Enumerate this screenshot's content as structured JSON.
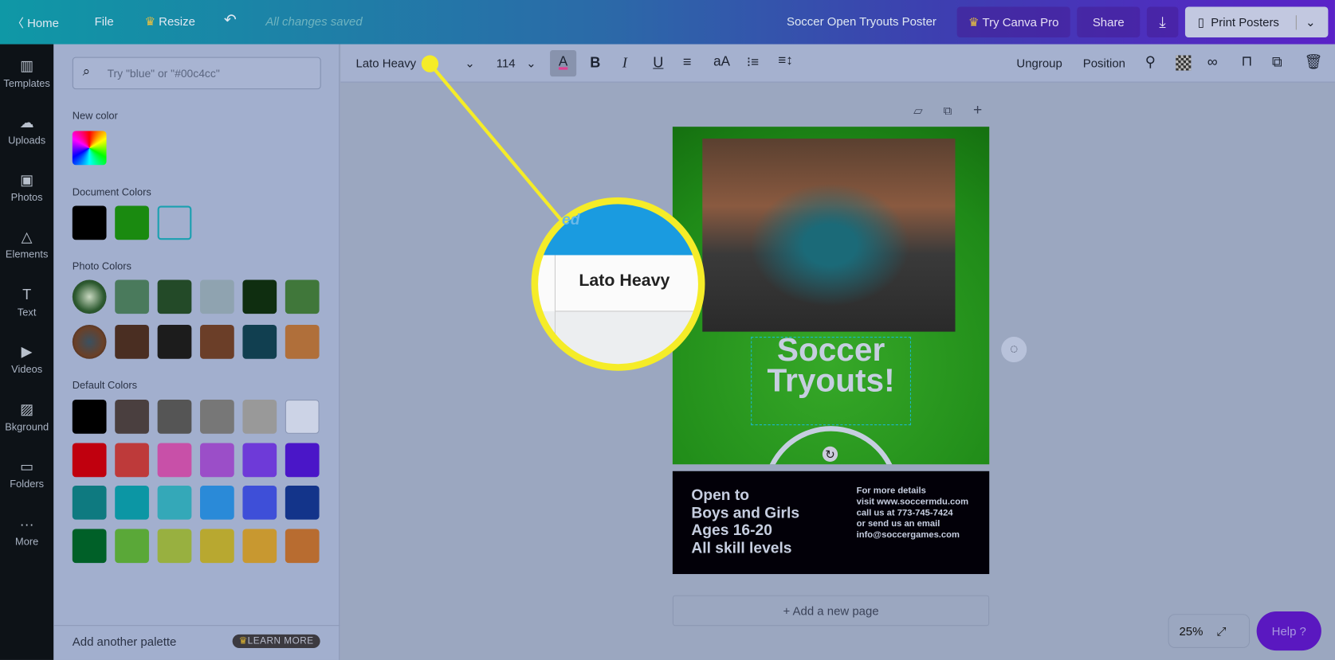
{
  "topbar": {
    "home": "Home",
    "file": "File",
    "resize": "Resize",
    "status": "All changes saved",
    "title": "Soccer Open Tryouts Poster",
    "try_pro": "Try Canva Pro",
    "share": "Share",
    "print": "Print Posters"
  },
  "nav": [
    {
      "label": "Templates",
      "icon": "layout-icon"
    },
    {
      "label": "Uploads",
      "icon": "cloud-upload-icon"
    },
    {
      "label": "Photos",
      "icon": "image-icon"
    },
    {
      "label": "Elements",
      "icon": "shapes-icon"
    },
    {
      "label": "Text",
      "icon": "text-icon"
    },
    {
      "label": "Videos",
      "icon": "video-icon"
    },
    {
      "label": "Bkground",
      "icon": "background-icon"
    },
    {
      "label": "Folders",
      "icon": "folder-icon"
    },
    {
      "label": "More",
      "icon": "more-icon"
    }
  ],
  "panel": {
    "search_placeholder": "Try \"blue\" or \"#00c4cc\"",
    "new_color": "New color",
    "document_colors": "Document Colors",
    "photo_colors": "Photo Colors",
    "default_colors": "Default Colors",
    "add_palette": "Add another palette",
    "learn_more": "LEARN MORE",
    "document": [
      "#000000",
      "#1a8a10",
      "#a2afce"
    ],
    "photo_row1": [
      "#4a7a5c",
      "#234a28",
      "#8fa3b0",
      "#0f2e10",
      "#40773a"
    ],
    "photo_row2": [
      "#4a2e22",
      "#1c1c1c",
      "#6b3e28",
      "#113f50",
      "#b06f3a"
    ],
    "defaults": [
      [
        "#000000",
        "#4a3f3f",
        "#555555",
        "#777777",
        "#999999",
        "#ccd3e6"
      ],
      [
        "#c0000e",
        "#be3a3a",
        "#c850a8",
        "#9b4ec8",
        "#6e3ad8",
        "#4a16c8"
      ],
      [
        "#0e7a80",
        "#0c96a4",
        "#34a8b8",
        "#2a8ad8",
        "#3e4fd8",
        "#13348a"
      ],
      [
        "#006028",
        "#5aa838",
        "#98b040",
        "#b8a830",
        "#c89830",
        "#b86c30"
      ]
    ]
  },
  "toolbar": {
    "font": "Lato Heavy",
    "size": "114",
    "ungroup": "Ungroup",
    "position": "Position"
  },
  "magnifier": {
    "text": "Lato Heavy",
    "partial": "ed"
  },
  "poster": {
    "headline1": "Soccer",
    "headline2": "Tryouts!",
    "left": [
      "Open to",
      "Boys and Girls",
      "Ages 16-20",
      "All skill levels"
    ],
    "right": [
      "For more details",
      "visit www.soccermdu.com",
      "call us at 773-745-7424",
      "or send us an email",
      "info@soccergames.com"
    ]
  },
  "canvas": {
    "add_page": "+ Add a new page",
    "zoom": "25%",
    "help": "Help  ?"
  }
}
